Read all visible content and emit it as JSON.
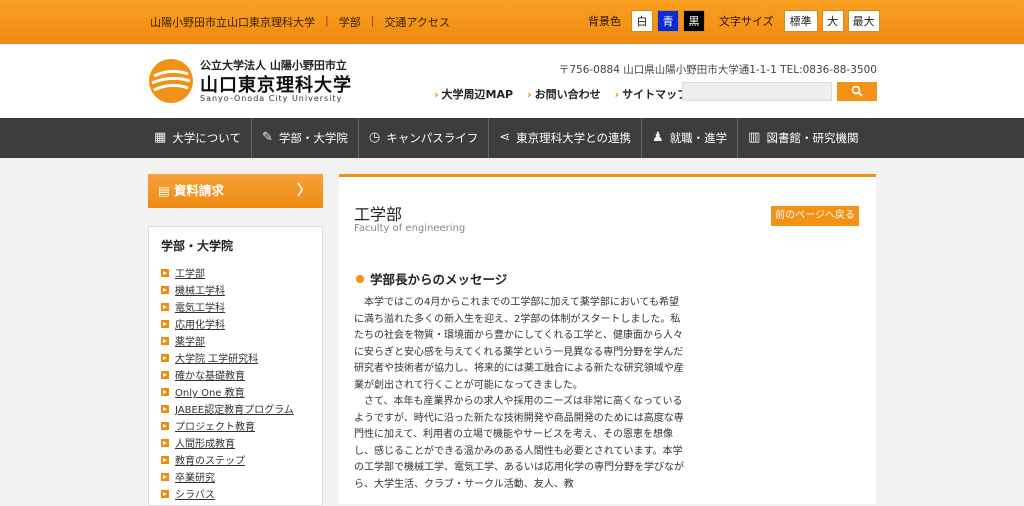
{
  "topbar": {
    "links": [
      "山陽小野田市立山口東京理科大学",
      "学部",
      "交通アクセス"
    ],
    "bg_label": "背景色",
    "bg_options": [
      "白",
      "青",
      "黒"
    ],
    "font_label": "文字サイズ",
    "font_options": [
      "標準",
      "大",
      "最大"
    ]
  },
  "header": {
    "logo_line1": "公立大学法人 山陽小野田市立",
    "logo_line2": "山口東京理科大学",
    "logo_line3": "Sanyo-Onoda City University",
    "address": "〒756-0884 山口県山陽小野田市大学通1-1-1 TEL:0836-88-3500",
    "links": [
      "大学周辺MAP",
      "お問い合わせ",
      "サイトマップ"
    ],
    "search_placeholder": "",
    "search_icon": "search-icon"
  },
  "nav": [
    {
      "label": "大学について",
      "icon": "building-icon"
    },
    {
      "label": "学部・大学院",
      "icon": "pen-icon"
    },
    {
      "label": "キャンパスライフ",
      "icon": "clock-icon"
    },
    {
      "label": "東京理科大学との連携",
      "icon": "share-icon"
    },
    {
      "label": "就職・進学",
      "icon": "person-icon"
    },
    {
      "label": "図書館・研究機関",
      "icon": "book-icon"
    }
  ],
  "sidebar": {
    "request_label": "資料請求",
    "section_title": "学部・大学院",
    "items": [
      "工学部",
      "機械工学科",
      "電気工学科",
      "応用化学科",
      "薬学部",
      "大学院 工学研究科",
      "確かな基礎教育",
      "Only One 教育",
      "JABEE認定教育プログラム",
      "プロジェクト教育",
      "人間形成教育",
      "教育のステップ",
      "卒業研究",
      "シラバス"
    ]
  },
  "main": {
    "title": "工学部",
    "subtitle": "Faculty of engineering",
    "back_label": "前のページへ戻る",
    "section_title": "学部長からのメッセージ",
    "para1": "本学ではこの4月からこれまでの工学部に加えて薬学部においても希望に満ち溢れた多くの新入生を迎え、2学部の体制がスタートしました。私たちの社会を物質・環境面から豊かにしてくれる工学と、健康面から人々に安らぎと安心感を与えてくれる薬学という一見異なる専門分野を学んだ研究者や技術者が協力し、将来的には薬工融合による新たな研究領域や産業が創出されて行くことが可能になってきました。",
    "para2": "さて、本年も産業界からの求人や採用のニーズは非常に高くなっているようですが、時代に沿った新たな技術開発や商品開発のためには高度な専門性に加えて、利用者の立場で機能やサービスを考え、その恩恵を想像し、感じることができる温かみのある人間性も必要とされています。本学の工学部で機械工学、電気工学、あるいは応用化学の専門分野を学びながら、大学生活、クラブ・サークル活動、友人、教"
  }
}
